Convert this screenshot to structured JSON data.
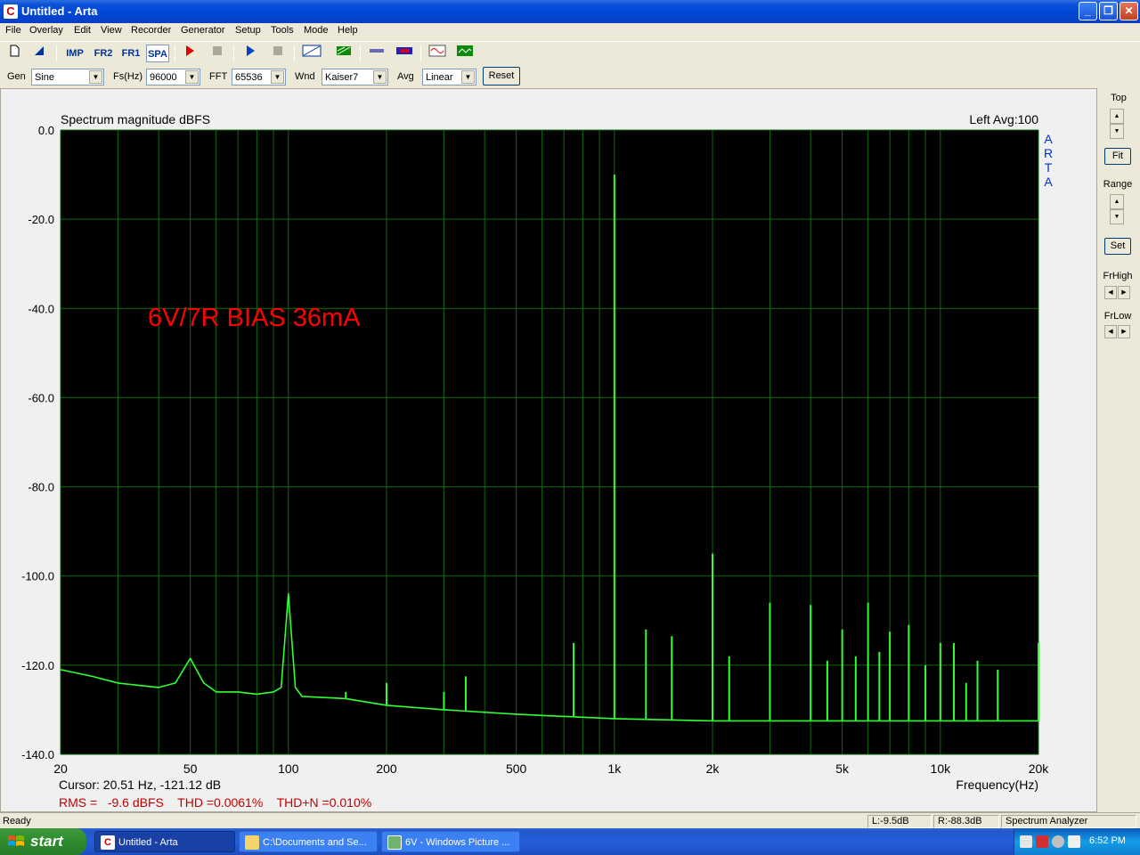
{
  "window": {
    "title": "Untitled - Arta",
    "app_icon": "arta-icon"
  },
  "menu": [
    "File",
    "Overlay",
    "Edit",
    "View",
    "Recorder",
    "Generator",
    "Setup",
    "Tools",
    "Mode",
    "Help"
  ],
  "toolbar": {
    "imp": "IMP",
    "fr2": "FR2",
    "fr1": "FR1",
    "spa": "SPA"
  },
  "generator_bar": {
    "gen_label": "Gen",
    "gen_value": "Sine",
    "fs_label": "Fs(Hz)",
    "fs_value": "96000",
    "fft_label": "FFT",
    "fft_value": "65536",
    "wnd_label": "Wnd",
    "wnd_value": "Kaiser7",
    "avg_label": "Avg",
    "avg_value": "Linear",
    "reset_label": "Reset"
  },
  "side_panel": {
    "top_label": "Top",
    "fit_label": "Fit",
    "range_label": "Range",
    "set_label": "Set",
    "frhigh_label": "FrHigh",
    "frlow_label": "FrLow"
  },
  "plot": {
    "header_left": "Spectrum magnitude dBFS",
    "header_right": "Left  Avg:100",
    "brand": [
      "A",
      "R",
      "T",
      "A"
    ],
    "annotation": "6V/7R BIAS 36mA",
    "cursor_text": "Cursor: 20.51 Hz, -121.12 dB",
    "xaxis_title": "Frequency(Hz)",
    "stats_text": "RMS =   -9.6 dBFS    THD =0.0061%    THD+N =0.010%",
    "colors": {
      "background": "#000000",
      "grid": "#0c6b0c",
      "trace": "#33ff33",
      "annotation": "#ff0000",
      "stats": "#c00000"
    }
  },
  "chart_data": {
    "type": "line",
    "title": "Spectrum magnitude dBFS",
    "xlabel": "Frequency(Hz)",
    "ylabel": "",
    "x_scale": "log",
    "xlim": [
      20,
      20000
    ],
    "ylim": [
      -140,
      0
    ],
    "grid": true,
    "x_tick_labels": [
      "20",
      "50",
      "100",
      "200",
      "500",
      "1k",
      "2k",
      "5k",
      "10k",
      "20k"
    ],
    "x_tick_values": [
      20,
      50,
      100,
      200,
      500,
      1000,
      2000,
      5000,
      10000,
      20000
    ],
    "y_tick_labels": [
      "0.0",
      "-20.0",
      "-40.0",
      "-60.0",
      "-80.0",
      "-100.0",
      "-120.0",
      "-140.0"
    ],
    "y_tick_values": [
      0,
      -20,
      -40,
      -60,
      -80,
      -100,
      -120,
      -140
    ],
    "noise_floor": [
      [
        20,
        -121
      ],
      [
        25,
        -122.5
      ],
      [
        30,
        -124
      ],
      [
        40,
        -125
      ],
      [
        45,
        -124
      ],
      [
        50,
        -118.5
      ],
      [
        55,
        -124
      ],
      [
        60,
        -126
      ],
      [
        70,
        -126
      ],
      [
        80,
        -126.5
      ],
      [
        90,
        -126
      ],
      [
        95,
        -125
      ],
      [
        100,
        -104
      ],
      [
        105,
        -125
      ],
      [
        110,
        -127
      ],
      [
        150,
        -127.5
      ],
      [
        200,
        -129
      ],
      [
        300,
        -130
      ],
      [
        500,
        -131
      ],
      [
        700,
        -131.5
      ],
      [
        1000,
        -132
      ],
      [
        2000,
        -132.5
      ],
      [
        5000,
        -132.5
      ],
      [
        10000,
        -132.5
      ],
      [
        20000,
        -132.5
      ]
    ],
    "peaks": [
      {
        "x": 50,
        "y": -118.5
      },
      {
        "x": 100,
        "y": -104
      },
      {
        "x": 150,
        "y": -126
      },
      {
        "x": 200,
        "y": -124
      },
      {
        "x": 300,
        "y": -126
      },
      {
        "x": 350,
        "y": -122.5
      },
      {
        "x": 750,
        "y": -115
      },
      {
        "x": 1000,
        "y": -10
      },
      {
        "x": 1250,
        "y": -112
      },
      {
        "x": 1500,
        "y": -113.5
      },
      {
        "x": 2000,
        "y": -95
      },
      {
        "x": 2250,
        "y": -118
      },
      {
        "x": 3000,
        "y": -106
      },
      {
        "x": 4000,
        "y": -106.5
      },
      {
        "x": 4500,
        "y": -119
      },
      {
        "x": 5000,
        "y": -112
      },
      {
        "x": 5500,
        "y": -118
      },
      {
        "x": 6000,
        "y": -106
      },
      {
        "x": 6500,
        "y": -117
      },
      {
        "x": 7000,
        "y": -112.5
      },
      {
        "x": 8000,
        "y": -111
      },
      {
        "x": 9000,
        "y": -120
      },
      {
        "x": 10000,
        "y": -115
      },
      {
        "x": 11000,
        "y": -115
      },
      {
        "x": 12000,
        "y": -124
      },
      {
        "x": 13000,
        "y": -119
      },
      {
        "x": 15000,
        "y": -121
      },
      {
        "x": 20000,
        "y": -115
      }
    ]
  },
  "status": {
    "left": "Ready",
    "l_level": "L:-9.5dB",
    "r_level": "R:-88.3dB",
    "mode": "Spectrum Analyzer"
  },
  "taskbar": {
    "start_label": "start",
    "tasks": [
      {
        "label": "Untitled - Arta",
        "icon": "arta-icon"
      },
      {
        "label": "C:\\Documents and Se...",
        "icon": "folder-icon"
      },
      {
        "label": "6V - Windows Picture ...",
        "icon": "picture-viewer-icon"
      }
    ],
    "clock": "6:52 PM"
  }
}
